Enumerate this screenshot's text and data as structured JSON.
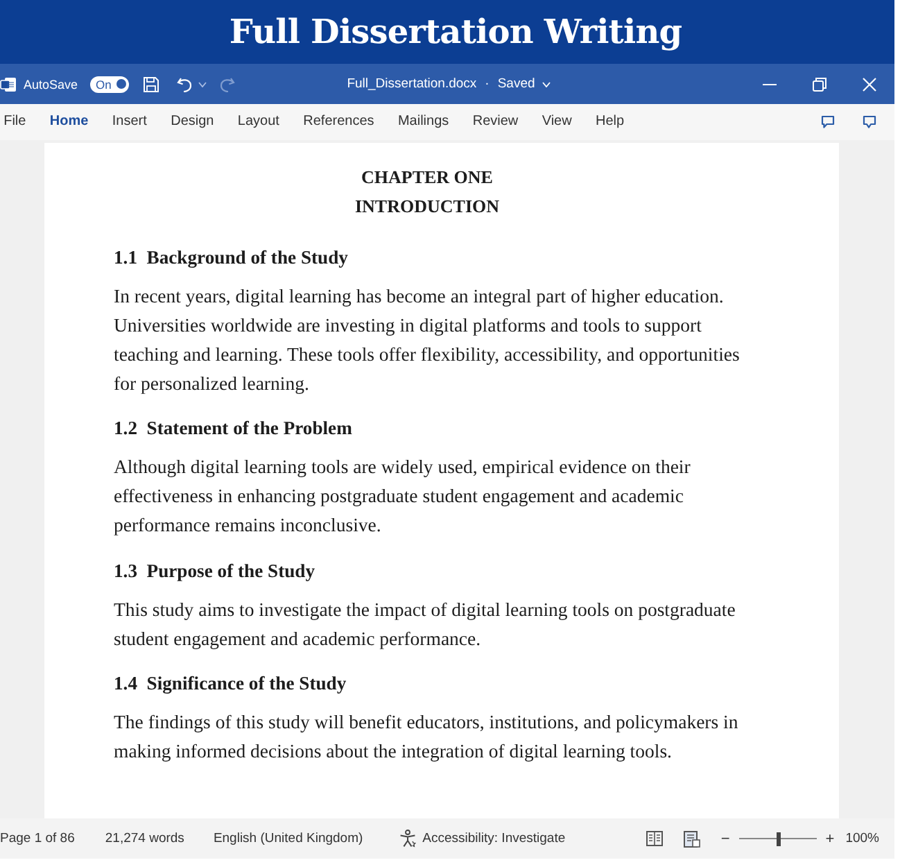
{
  "banner": {
    "title": "Full Dissertation Writing"
  },
  "title_bar": {
    "autosave_label": "AutoSave",
    "autosave": {
      "on": true,
      "label": "On"
    },
    "filename": "Full_Dissertation.docx",
    "separator": "·",
    "save_status": "Saved"
  },
  "ribbon": {
    "tabs": [
      {
        "label": "File",
        "selected": false
      },
      {
        "label": "Home",
        "selected": true
      },
      {
        "label": "Insert",
        "selected": false
      },
      {
        "label": "Design",
        "selected": false
      },
      {
        "label": "Layout",
        "selected": false
      },
      {
        "label": "References",
        "selected": false
      },
      {
        "label": "Mailings",
        "selected": false
      },
      {
        "label": "Review",
        "selected": false
      },
      {
        "label": "View",
        "selected": false
      },
      {
        "label": "Help",
        "selected": false
      }
    ]
  },
  "document": {
    "chapter": [
      "CHAPTER ONE",
      "INTRODUCTION"
    ],
    "sections": [
      {
        "heading": "1.1  Background of the Study",
        "body": "In recent years, digital learning has become an integral part of higher education. Universities worldwide are investing in digital platforms and tools to support teaching and learning. These tools offer flexibility, accessibility, and opportunities for personalized learning."
      },
      {
        "heading": "1.2  Statement of the Problem",
        "body": "Although digital learning tools are widely used, empirical evidence on their effectiveness in enhancing postgraduate student engagement and academic performance remains inconclusive."
      },
      {
        "heading": "1.3  Purpose of the Study",
        "body": "This study aims to investigate the impact of digital learning tools on postgraduate student engagement and academic performance."
      },
      {
        "heading": "1.4  Significance of the Study",
        "body": "The findings of this study will benefit educators, institutions, and policymakers in making informed decisions about the integration of digital learning tools."
      }
    ]
  },
  "status_bar": {
    "page": "Page 1 of 86",
    "words": "21,274 words",
    "language": "English (United Kingdom)",
    "accessibility": "Accessibility: Investigate",
    "zoom": {
      "minus": "−",
      "plus": "+",
      "level": 0.5,
      "reading": "100%"
    }
  }
}
